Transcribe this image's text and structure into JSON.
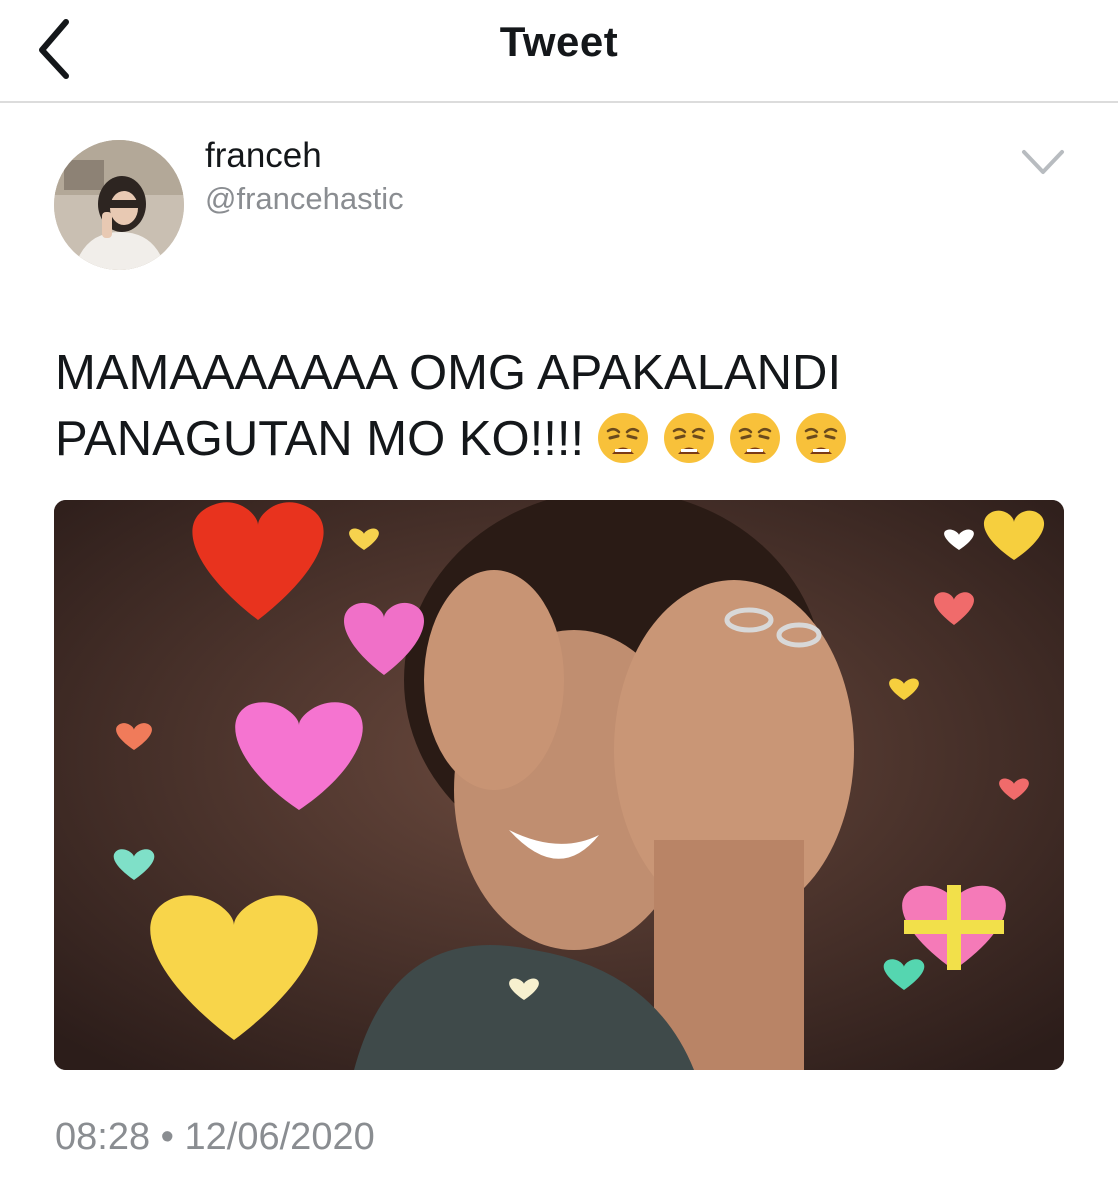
{
  "header": {
    "title": "Tweet"
  },
  "tweet": {
    "author": {
      "display_name": "franceh",
      "handle": "@francehastic"
    },
    "text_line1": "MAMAAAAAAA OMG APAKALANDI",
    "text_line2": "PANAGUTAN MO KO!!!!",
    "emoji_count": 4,
    "emoji": "weary-face",
    "time": "08:28",
    "separator": "•",
    "date": "12/06/2020"
  },
  "colors": {
    "text": "#14171a",
    "secondary": "#8a8d91",
    "divider": "#dcdcdc"
  }
}
